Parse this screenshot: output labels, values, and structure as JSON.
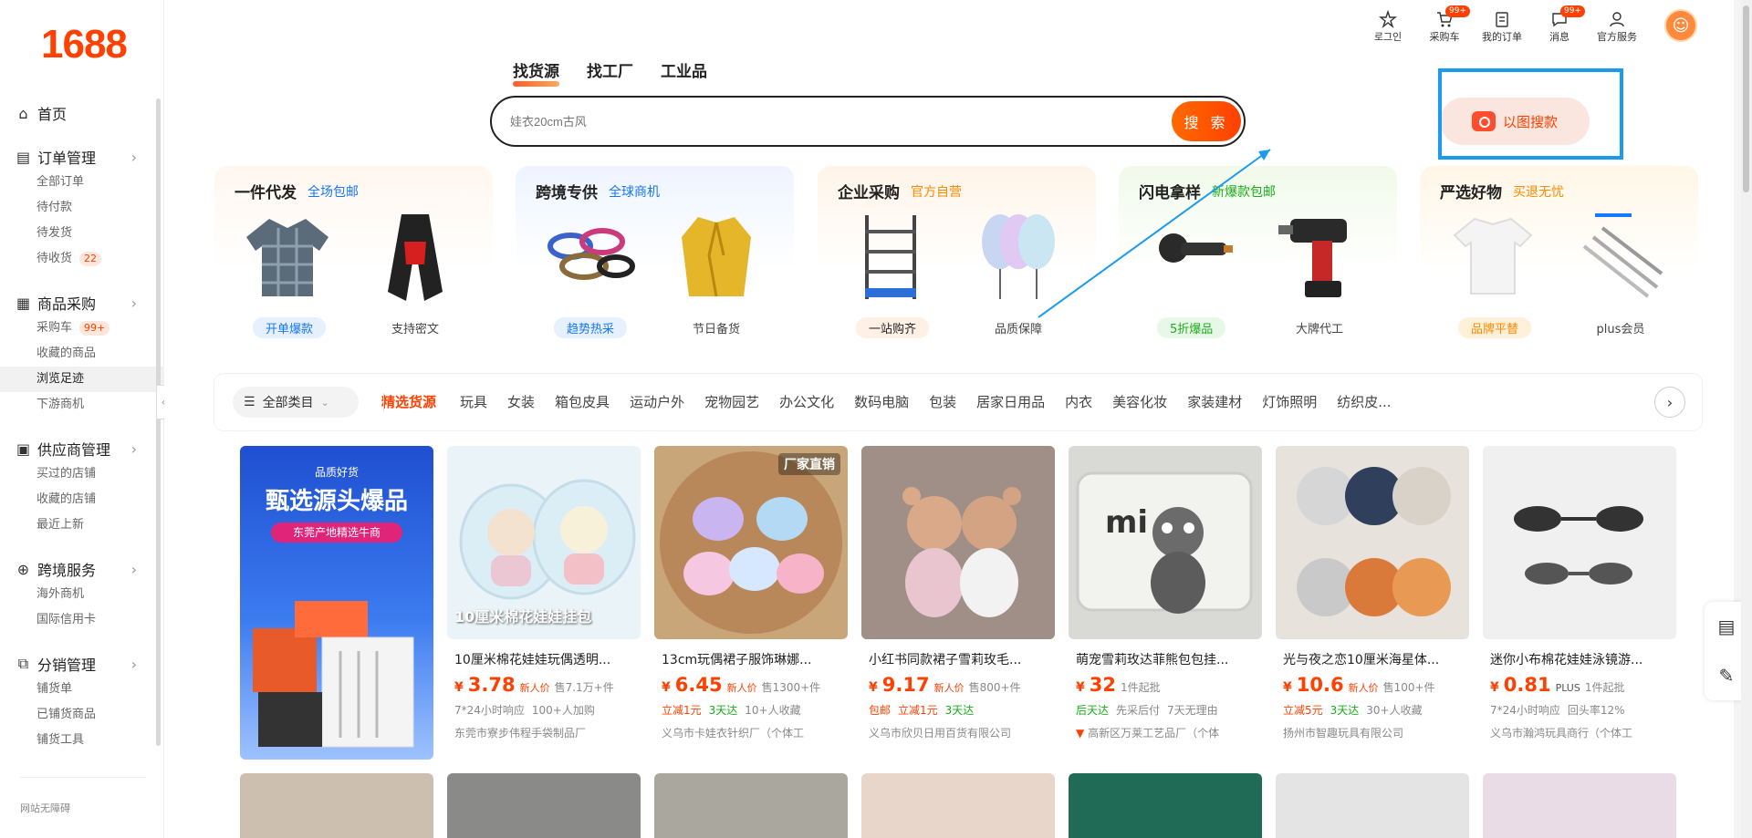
{
  "logo": "1688",
  "sidebar": {
    "home": "首页",
    "groups": [
      {
        "title": "订单管理",
        "icon": "clipboard-icon",
        "items": [
          {
            "label": "全部订单"
          },
          {
            "label": "待付款"
          },
          {
            "label": "待发货"
          },
          {
            "label": "待收货",
            "badge": "22"
          }
        ]
      },
      {
        "title": "商品采购",
        "icon": "grid-icon",
        "items": [
          {
            "label": "采购车",
            "badge": "99+"
          },
          {
            "label": "收藏的商品"
          },
          {
            "label": "浏览足迹",
            "active": true
          },
          {
            "label": "下游商机"
          }
        ]
      },
      {
        "title": "供应商管理",
        "icon": "store-icon",
        "items": [
          {
            "label": "买过的店铺"
          },
          {
            "label": "收藏的店铺"
          },
          {
            "label": "最近上新"
          }
        ]
      },
      {
        "title": "跨境服务",
        "icon": "globe-icon",
        "items": [
          {
            "label": "海外商机"
          },
          {
            "label": "国际信用卡"
          }
        ]
      },
      {
        "title": "分销管理",
        "icon": "share-icon",
        "items": [
          {
            "label": "铺货单"
          },
          {
            "label": "已铺货商品"
          },
          {
            "label": "铺货工具"
          }
        ]
      }
    ],
    "footer": "网站无障碍"
  },
  "topbar": {
    "items": [
      {
        "label": "로그인",
        "icon": "star-icon",
        "badge": ""
      },
      {
        "label": "采购车",
        "icon": "cart-icon",
        "badge": "99+"
      },
      {
        "label": "我的订单",
        "icon": "order-icon",
        "badge": ""
      },
      {
        "label": "消息",
        "icon": "message-icon",
        "badge": "99+"
      },
      {
        "label": "官方服务",
        "icon": "user-icon",
        "badge": ""
      }
    ]
  },
  "search": {
    "tabs": [
      "找货源",
      "找工厂",
      "工业品"
    ],
    "placeholder": "娃衣20cm古风",
    "button": "搜 索",
    "image_search": "以图搜款"
  },
  "category_cards": [
    {
      "title": "一件代发",
      "subtitle": "全场包邮",
      "sub_color": "#1677ff",
      "tag": "开单爆款",
      "tag_bg": "#e6f0ff",
      "tag_color": "#1677ff",
      "caption": "支持密文",
      "bg": "#eef4ff"
    },
    {
      "title": "跨境专供",
      "subtitle": "全球商机",
      "sub_color": "#1677ff",
      "tag": "趋势热采",
      "tag_bg": "#e6f0ff",
      "tag_color": "#1677ff",
      "caption": "节日备货",
      "bg": "#eef4ff"
    },
    {
      "title": "企业采购",
      "subtitle": "官方自营",
      "sub_color": "#ff8a00",
      "tag": "一站购齐",
      "tag_bg": "#fff0e6",
      "tag_color": "#ff4000",
      "caption": "品质保障",
      "bg": "#fff4e8"
    },
    {
      "title": "闪电拿样",
      "subtitle": "新爆款包邮",
      "sub_color": "#1aad19",
      "tag": "5折爆品",
      "tag_bg": "#e8f8e8",
      "tag_color": "#1aad19",
      "caption": "大牌代工",
      "bg": "#f1faea"
    },
    {
      "title": "严选好物",
      "subtitle": "买退无忧",
      "sub_color": "#ff8a00",
      "tag": "品牌平替",
      "tag_bg": "#fff0d9",
      "tag_color": "#ff8a00",
      "caption": "plus会员",
      "bg": "#fff6e6"
    }
  ],
  "filter": {
    "all": "全部类目",
    "categories": [
      "精选货源",
      "玩具",
      "女装",
      "箱包皮具",
      "运动户外",
      "宠物园艺",
      "办公文化",
      "数码电脑",
      "包装",
      "居家日用品",
      "内衣",
      "美容化妆",
      "家装建材",
      "灯饰照明",
      "纺织皮..."
    ]
  },
  "banner": {
    "tag": "品质好货",
    "headline": "甄选源头爆品",
    "sub": "东莞产地精选牛商"
  },
  "products": [
    {
      "title": "10厘米棉花娃娃玩偶透明...",
      "price": "3.78",
      "price_tag": "新人价",
      "sold": "售7.1万+件",
      "line2": [
        [
          "7*24小时响应",
          ""
        ],
        [
          "100+人加购",
          ""
        ]
      ],
      "shop": "东莞市寮步伟程手袋制品厂",
      "overlay": "10厘米棉花娃娃挂包",
      "bg": "#eaf4f8"
    },
    {
      "title": "13cm玩偶裙子服饰琳娜...",
      "price": "6.45",
      "price_tag": "新人价",
      "sold": "售1300+件",
      "line2": [
        [
          "立减1元",
          "r"
        ],
        [
          "3天达",
          "g"
        ],
        [
          "10+人收藏",
          ""
        ]
      ],
      "shop": "义乌市卡娃衣针织厂（个体工",
      "overlay": "厂家直销",
      "bg": "#c9a57a"
    },
    {
      "title": "小红书同款裙子雪莉玫毛...",
      "price": "9.17",
      "price_tag": "新人价",
      "sold": "售800+件",
      "line2": [
        [
          "包邮",
          "r"
        ],
        [
          "立减1元",
          "r"
        ],
        [
          "3天达",
          "g"
        ]
      ],
      "shop": "义乌市欣贝日用百货有限公司",
      "overlay": "",
      "bg": "#b89a8a"
    },
    {
      "title": "萌宠雪莉玫达菲熊包包挂...",
      "price": "32",
      "price_tag": "",
      "sold": "1件起批",
      "line2": [
        [
          "后天达",
          "g"
        ],
        [
          "先采后付",
          ""
        ],
        [
          "7天无理由",
          ""
        ]
      ],
      "shop": "高新区万莱工艺品厂（个体",
      "overlay": "",
      "bg": "#d9d9d6"
    },
    {
      "title": "光与夜之恋10厘米海星体...",
      "price": "10.6",
      "price_tag": "新人价",
      "sold": "售100+件",
      "line2": [
        [
          "立减5元",
          "r"
        ],
        [
          "3天达",
          "g"
        ],
        [
          "30+人收藏",
          ""
        ]
      ],
      "shop": "扬州市智趣玩具有限公司",
      "overlay": "",
      "bg": "#e8e2dc"
    },
    {
      "title": "迷你小布棉花娃娃泳镜游...",
      "price": "0.81",
      "price_tag": "PLUS",
      "sold": "1件起批",
      "line2": [
        [
          "7*24小时响应",
          ""
        ],
        [
          "回头率12%",
          ""
        ]
      ],
      "shop": "义乌市瀚鸿玩具商行（个体工",
      "overlay": "",
      "bg": "#f0f0f0"
    }
  ],
  "colors": {
    "brand": "#ff4000",
    "highlight": "#1a9bf0"
  }
}
